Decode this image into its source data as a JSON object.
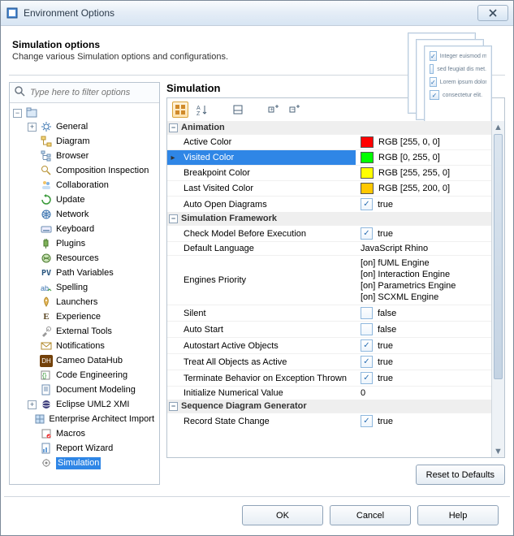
{
  "window": {
    "title": "Environment Options"
  },
  "header": {
    "title": "Simulation options",
    "desc": "Change various Simulation options and configurations.",
    "illus_lines": [
      "Integer euismod mollis",
      "sed feugiat dis met.",
      "Lorem ipsum dolor",
      "consectetur elit."
    ]
  },
  "filter": {
    "placeholder": "Type here to filter options"
  },
  "tree": {
    "items": [
      {
        "label": "General",
        "icon": "gear",
        "expander": "+"
      },
      {
        "label": "Diagram",
        "icon": "flow",
        "expander": ""
      },
      {
        "label": "Browser",
        "icon": "tree",
        "expander": ""
      },
      {
        "label": "Composition Inspection",
        "icon": "mag",
        "expander": ""
      },
      {
        "label": "Collaboration",
        "icon": "people",
        "expander": ""
      },
      {
        "label": "Update",
        "icon": "update",
        "expander": ""
      },
      {
        "label": "Network",
        "icon": "net",
        "expander": ""
      },
      {
        "label": "Keyboard",
        "icon": "kbd",
        "expander": ""
      },
      {
        "label": "Plugins",
        "icon": "plug",
        "expander": ""
      },
      {
        "label": "Resources",
        "icon": "res",
        "expander": ""
      },
      {
        "label": "Path Variables",
        "icon": "PV",
        "expander": ""
      },
      {
        "label": "Spelling",
        "icon": "abc",
        "expander": ""
      },
      {
        "label": "Launchers",
        "icon": "rocket",
        "expander": ""
      },
      {
        "label": "Experience",
        "icon": "E",
        "expander": ""
      },
      {
        "label": "External Tools",
        "icon": "tools",
        "expander": ""
      },
      {
        "label": "Notifications",
        "icon": "mail",
        "expander": ""
      },
      {
        "label": "Cameo DataHub",
        "icon": "DH",
        "expander": ""
      },
      {
        "label": "Code Engineering",
        "icon": "code",
        "expander": ""
      },
      {
        "label": "Document Modeling",
        "icon": "doc",
        "expander": ""
      },
      {
        "label": "Eclipse UML2 XMI",
        "icon": "eclipse",
        "expander": "+"
      },
      {
        "label": "Enterprise Architect Import",
        "icon": "ea",
        "expander": ""
      },
      {
        "label": "Macros",
        "icon": "macro",
        "expander": ""
      },
      {
        "label": "Report Wizard",
        "icon": "report",
        "expander": ""
      },
      {
        "label": "Simulation",
        "icon": "sim",
        "expander": "",
        "selected": true
      }
    ]
  },
  "main": {
    "title": "Simulation",
    "categories": [
      {
        "name": "Animation",
        "rows": [
          {
            "name": "Active Color",
            "kind": "color",
            "color": "#ff0000",
            "text": "RGB [255, 0, 0]"
          },
          {
            "name": "Visited Color",
            "kind": "color",
            "color": "#00ff00",
            "text": "RGB [0, 255, 0]",
            "selected": true
          },
          {
            "name": "Breakpoint Color",
            "kind": "color",
            "color": "#ffff00",
            "text": "RGB [255, 255, 0]"
          },
          {
            "name": "Last Visited Color",
            "kind": "color",
            "color": "#ffc800",
            "text": "RGB [255, 200, 0]"
          },
          {
            "name": "Auto Open Diagrams",
            "kind": "bool",
            "checked": true,
            "text": "true"
          }
        ]
      },
      {
        "name": "Simulation Framework",
        "rows": [
          {
            "name": "Check Model Before Execution",
            "kind": "bool",
            "checked": true,
            "text": "true"
          },
          {
            "name": "Default Language",
            "kind": "text",
            "text": "JavaScript Rhino"
          },
          {
            "name": "Engines Priority",
            "kind": "multi",
            "lines": [
              "[on] fUML Engine",
              "[on] Interaction Engine",
              "[on] Parametrics Engine",
              "[on] SCXML Engine"
            ]
          },
          {
            "name": "Silent",
            "kind": "bool",
            "checked": false,
            "text": "false"
          },
          {
            "name": "Auto Start",
            "kind": "bool",
            "checked": false,
            "text": "false"
          },
          {
            "name": "Autostart Active Objects",
            "kind": "bool",
            "checked": true,
            "text": "true"
          },
          {
            "name": "Treat All Objects as Active",
            "kind": "bool",
            "checked": true,
            "text": "true"
          },
          {
            "name": "Terminate Behavior on Exception Thrown",
            "kind": "bool",
            "checked": true,
            "text": "true"
          },
          {
            "name": "Initialize Numerical Value",
            "kind": "text",
            "text": "0"
          }
        ]
      },
      {
        "name": "Sequence Diagram Generator",
        "rows": [
          {
            "name": "Record State Change",
            "kind": "bool",
            "checked": true,
            "text": "true"
          }
        ]
      }
    ]
  },
  "buttons": {
    "reset": "Reset to Defaults",
    "ok": "OK",
    "cancel": "Cancel",
    "help": "Help"
  }
}
